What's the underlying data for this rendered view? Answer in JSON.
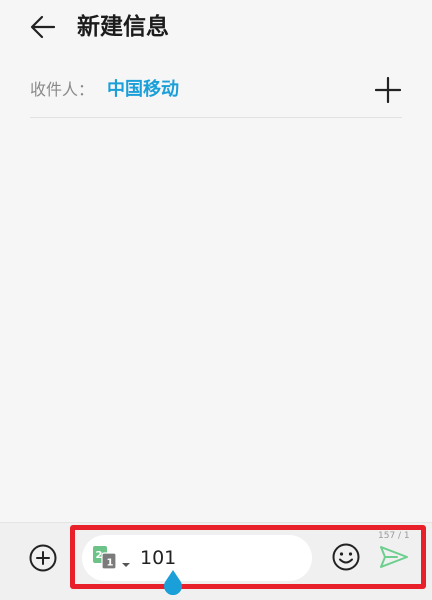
{
  "header": {
    "title": "新建信息",
    "back_icon": "back-arrow-icon"
  },
  "recipient": {
    "label": "收件人：",
    "value": "中国移动",
    "add_icon": "plus-icon"
  },
  "composer": {
    "attach_icon": "add-circle-icon",
    "sim_icon": "dual-sim-icon",
    "sim_badge_top": "2",
    "sim_badge_bottom": "1",
    "message_text": "101",
    "char_counter": "157 / 1",
    "emoji_icon": "emoji-icon",
    "send_icon": "send-icon"
  },
  "colors": {
    "accent": "#1a9fd8",
    "highlight": "#e8202a",
    "send": "#6ccf8e",
    "background": "#f6f6f6"
  }
}
